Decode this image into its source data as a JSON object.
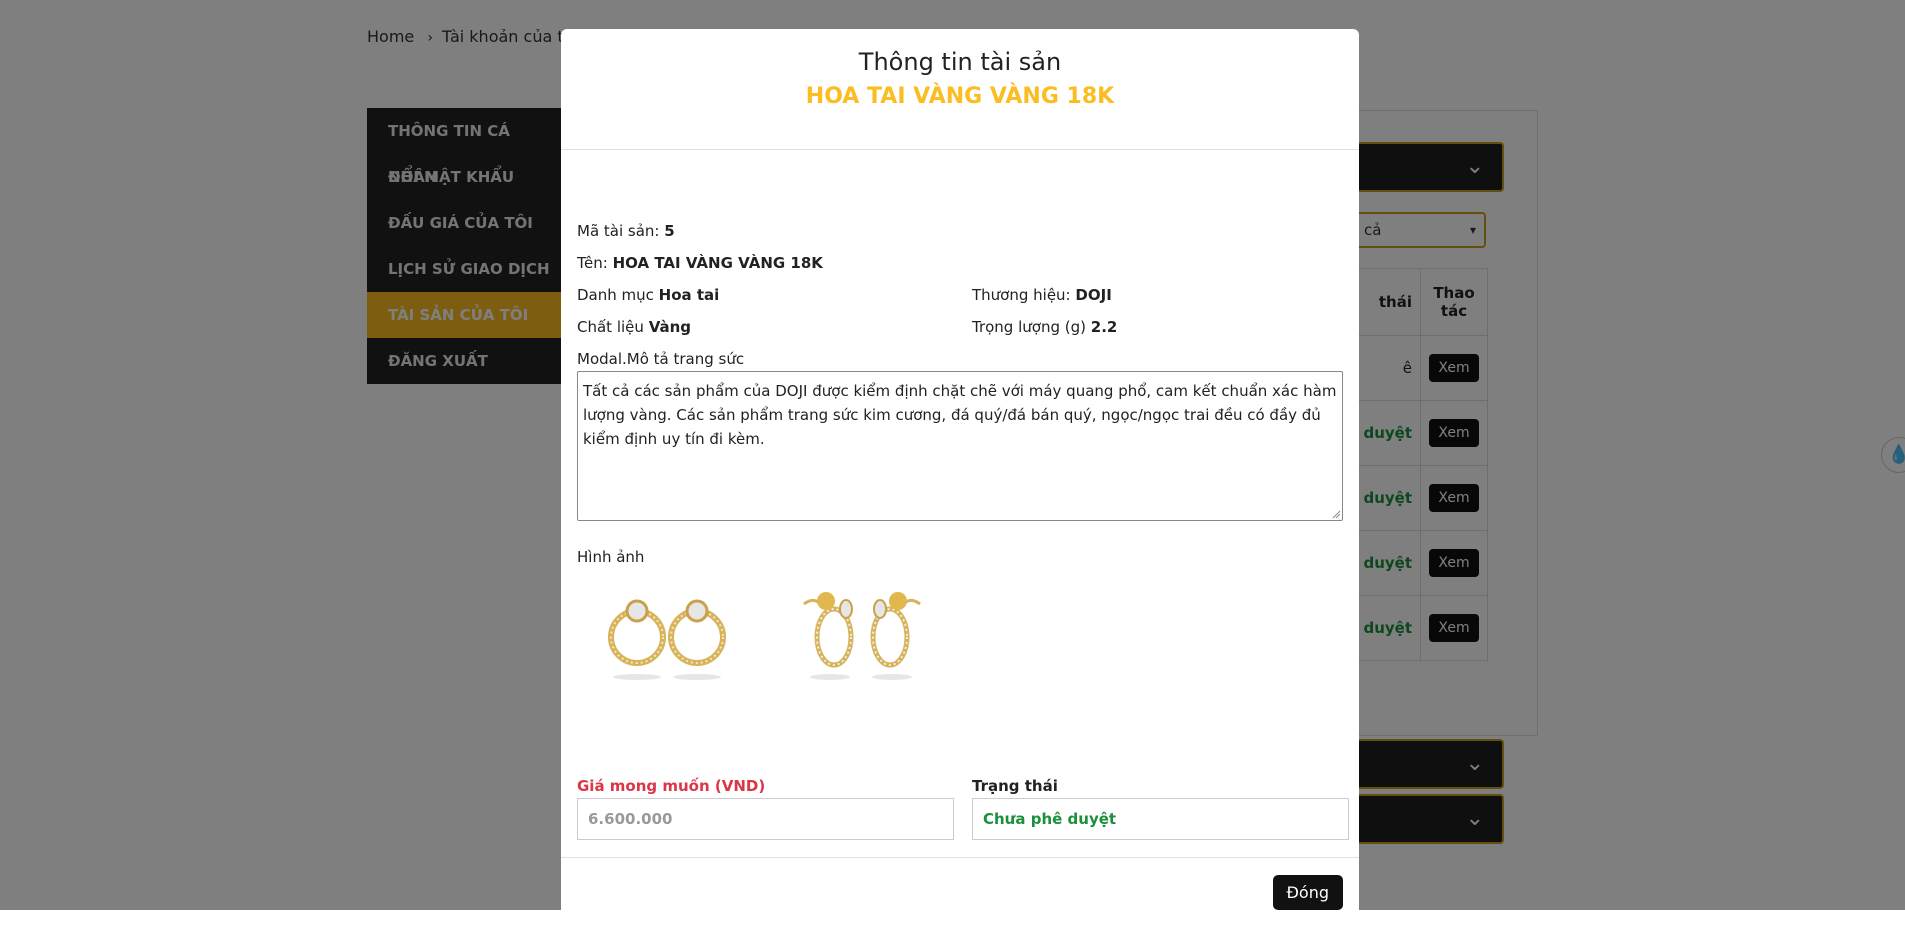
{
  "breadcrumb": {
    "home": "Home",
    "current": "Tài khoản của tôi"
  },
  "sidebar": {
    "items": [
      {
        "label": "THÔNG TIN CÁ NHÂN"
      },
      {
        "label": "ĐỔI MẬT KHẨU"
      },
      {
        "label": "ĐẤU GIÁ CỦA TÔI"
      },
      {
        "label": "LỊCH SỬ GIAO DỊCH"
      },
      {
        "label": "TÀI SẢN CỦA TÔI"
      },
      {
        "label": "ĐĂNG XUẤT"
      }
    ]
  },
  "background_table": {
    "filter_value": "cả",
    "header_status": "thái",
    "header_action": "Thao tác",
    "rows": [
      {
        "status": "ê",
        "action": "Xem"
      },
      {
        "status": "duyệt",
        "action": "Xem"
      },
      {
        "status": "duyệt",
        "action": "Xem"
      },
      {
        "status": "duyệt",
        "action": "Xem"
      },
      {
        "status": "duyệt",
        "action": "Xem"
      }
    ]
  },
  "modal": {
    "title": "Thông tin tài sản",
    "subtitle": "HOA TAI VÀNG VÀNG 18K",
    "asset_code_label": "Mã tài sản:",
    "asset_code": "5",
    "name_label": "Tên:",
    "name": "HOA TAI VÀNG VÀNG 18K",
    "category_label": "Danh mục",
    "category": "Hoa tai",
    "brand_label": "Thương hiệu:",
    "brand": "DOJI",
    "material_label": "Chất liệu",
    "material": "Vàng",
    "weight_label": "Trọng lượng (g)",
    "weight": "2.2",
    "desc_label": "Modal.Mô tả trang sức",
    "description": "Tất cả các sản phẩm của DOJI được kiểm định chặt chẽ với máy quang phổ, cam kết chuẩn xác hàm lượng vàng. Các sản phẩm trang sức kim cương, đá quý/đá bán quý, ngọc/ngọc trai đều có đầy đủ kiểm định uy tín đi kèm.",
    "images_label": "Hình ảnh",
    "price_label": "Giá mong muốn (VND)",
    "price": "6.600.000",
    "status_label": "Trạng thái",
    "status": "Chưa phê duyệt",
    "close_label": "Đóng"
  },
  "colors": {
    "accent": "#fbbd22",
    "price_label": "#dc3545",
    "status_green": "#1a8f3c"
  }
}
